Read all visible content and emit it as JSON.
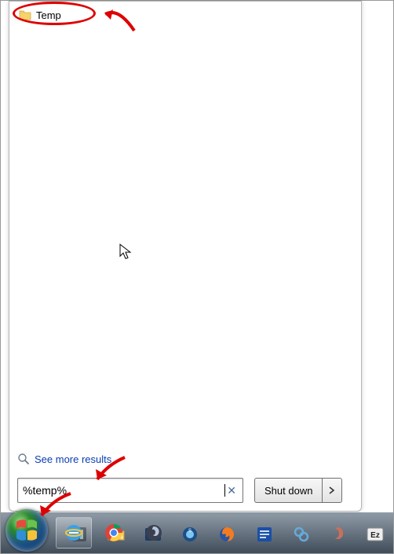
{
  "result": {
    "label": "Temp",
    "icon": "folder-icon"
  },
  "see_more": {
    "label": "See more results",
    "icon": "magnifier-icon"
  },
  "search": {
    "value": "%temp%",
    "clear_icon": "clear-icon"
  },
  "shutdown": {
    "label": "Shut down",
    "chevron_icon": "chevron-right-icon"
  },
  "taskbar": {
    "items": [
      {
        "name": "app-icon-1"
      },
      {
        "name": "explorer-icon"
      },
      {
        "name": "media-player-icon"
      },
      {
        "name": "app-orb-icon"
      },
      {
        "name": "firefox-icon"
      },
      {
        "name": "app-blue-icon"
      },
      {
        "name": "app-link-icon"
      },
      {
        "name": "app-dark-icon"
      },
      {
        "name": "app-ez-icon"
      },
      {
        "name": "ie-icon"
      },
      {
        "name": "chrome-icon"
      },
      {
        "name": "app-swirl-icon"
      }
    ]
  },
  "annotations": {
    "ellipse": "red-ellipse",
    "arrows": [
      "arrow-result",
      "arrow-search",
      "arrow-start"
    ]
  }
}
